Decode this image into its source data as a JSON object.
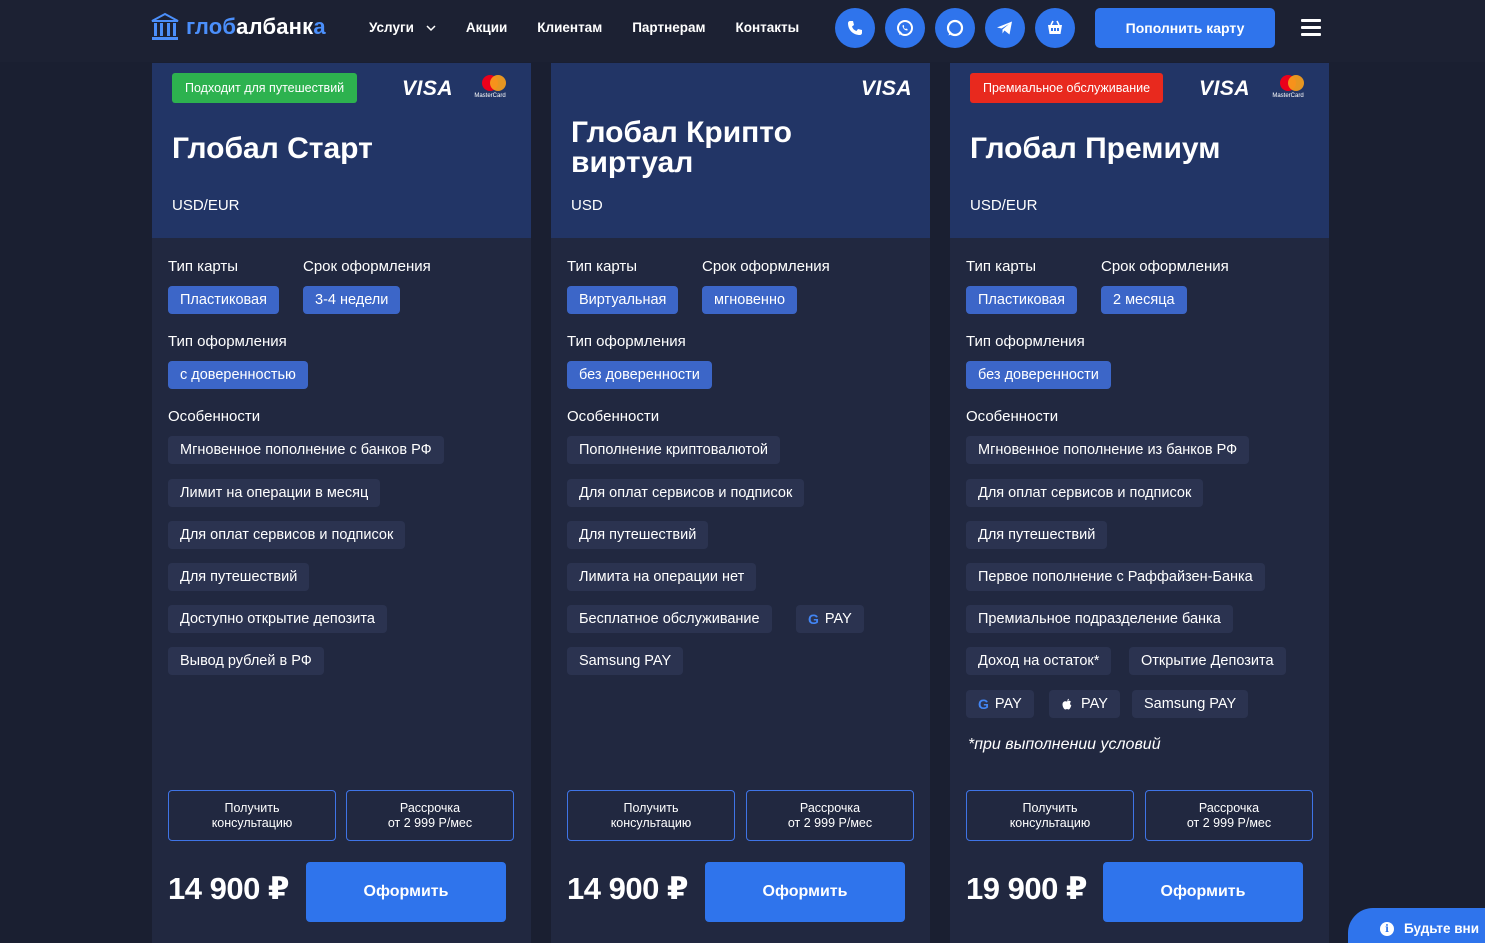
{
  "brand": {
    "part1": "глоб",
    "part2": "албанк",
    "part3": "а"
  },
  "nav": [
    {
      "label": "Услуги",
      "has_dropdown": true
    },
    {
      "label": "Акции"
    },
    {
      "label": "Клиентам"
    },
    {
      "label": "Партнерам"
    },
    {
      "label": "Контакты"
    }
  ],
  "contact_icons": [
    "phone-icon",
    "whatsapp-icon",
    "chat-icon",
    "telegram-icon",
    "basket-icon"
  ],
  "topup_label": "Пополнить карту",
  "colors": {
    "accent": "#2f74ec",
    "chip": "#3c66c8",
    "card_top": "#223566",
    "card_body": "#212840",
    "badge_green": "#2db24f",
    "badge_red": "#e8291e"
  },
  "labels": {
    "card_type": "Тип карты",
    "issue_time": "Срок оформления",
    "issue_type": "Тип оформления",
    "features": "Особенности",
    "visa": "VISA",
    "mastercard": "MasterCard",
    "consult_line1": "Получить",
    "consult_line2": "консультацию",
    "installment_line1": "Рассрочка",
    "installment_line2": "от 2 999 Р/мес",
    "apply": "Оформить"
  },
  "cards": [
    {
      "badge": "Подходит для путешествий",
      "title_line1": "Глобал Старт",
      "title_line2": "",
      "currency": "USD/EUR",
      "card_type": "Пластиковая",
      "issue_time": "3-4 недели",
      "issue_type": "с доверенностью",
      "features": [
        "Мгновенное пополнение с банков РФ",
        "Лимит на операции в месяц",
        "Для оплат сервисов и подписок",
        "Для путешествий",
        "Доступно открытие депозита",
        "Вывод рублей в РФ"
      ],
      "price": "14 900 ₽"
    },
    {
      "badge": "",
      "title_line1": "Глобал Крипто",
      "title_line2": "виртуал",
      "currency": "USD",
      "card_type": "Виртуальная",
      "issue_time": "мгновенно",
      "issue_type": "без доверенности",
      "features": [
        "Пополнение криптовалютой",
        "Для оплат сервисов и подписок",
        "Для путешествий",
        "Лимита на операции нет",
        "Бесплатное обслуживание",
        "PAY",
        "Samsung PAY"
      ],
      "price": "14 900 ₽"
    },
    {
      "badge": "Премиальное обслуживание",
      "title_line1": "Глобал Премиум",
      "title_line2": "",
      "currency": "USD/EUR",
      "card_type": "Пластиковая",
      "issue_time": "2 месяца",
      "issue_type": "без доверенности",
      "features": [
        "Мгновенное пополнение из банков РФ",
        "Для оплат сервисов и подписок",
        "Для путешествий",
        "Первое пополнение с Раффайзен-Банка",
        "Премиальное подразделение банка",
        "Доход на остаток*",
        "Открытие Депозита",
        "PAY",
        "PAY",
        "Samsung PAY"
      ],
      "note": "*при выполнении условий",
      "price": "19 900 ₽"
    }
  ],
  "notice": "Будьте вни"
}
